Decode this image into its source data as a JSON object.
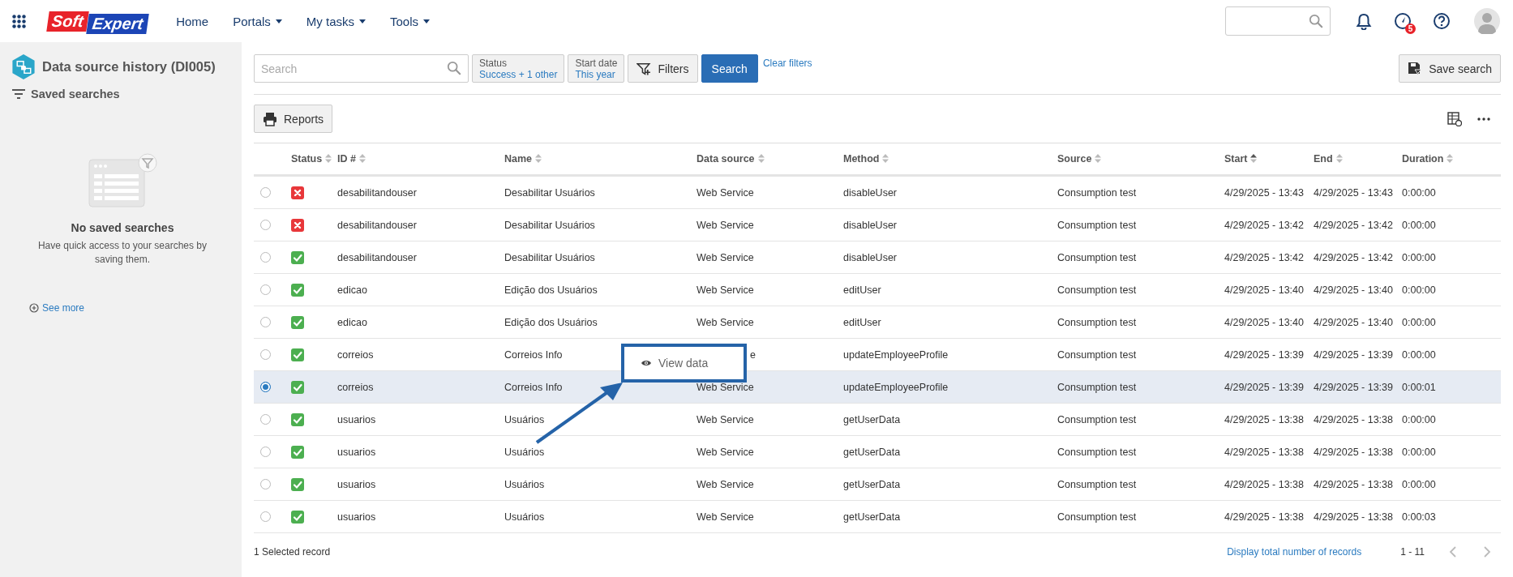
{
  "top_nav": {
    "logo": {
      "left": "Soft",
      "right": "Expert"
    },
    "menu": [
      {
        "label": "Home",
        "dropdown": false
      },
      {
        "label": "Portals",
        "dropdown": true
      },
      {
        "label": "My tasks",
        "dropdown": true
      },
      {
        "label": "Tools",
        "dropdown": true
      }
    ],
    "badge": "5"
  },
  "sidebar": {
    "title": "Data source history (DI005)",
    "saved_searches": "Saved searches",
    "empty_title": "No saved searches",
    "empty_text": "Have quick access to your searches by saving them.",
    "see_more": "See more"
  },
  "filter_bar": {
    "search": {
      "placeholder": "Search"
    },
    "chips": [
      {
        "label": "Status",
        "value": "Success + 1 other"
      },
      {
        "label": "Start date",
        "value": "This year"
      }
    ],
    "filters_button": "Filters",
    "search_button": "Search",
    "clear_filters": "Clear filters",
    "save_search": "Save search"
  },
  "reports_button": "Reports",
  "table": {
    "columns": [
      {
        "label": "Status",
        "sorted": false
      },
      {
        "label": "ID #",
        "sorted": false
      },
      {
        "label": "Name",
        "sorted": false
      },
      {
        "label": "Data source",
        "sorted": false
      },
      {
        "label": "Method",
        "sorted": false
      },
      {
        "label": "Source",
        "sorted": false
      },
      {
        "label": "Start",
        "sorted": true
      },
      {
        "label": "End",
        "sorted": false
      },
      {
        "label": "Duration",
        "sorted": false
      }
    ],
    "rows": [
      {
        "selected": false,
        "failed": true,
        "id": "desabilitandouser",
        "name": "Desabilitar Usuários",
        "data_source": "Web Service",
        "method": "disableUser",
        "source": "Consumption test",
        "start": "4/29/2025 - 13:43",
        "end": "4/29/2025 - 13:43",
        "duration": "0:00:00"
      },
      {
        "selected": false,
        "failed": true,
        "id": "desabilitandouser",
        "name": "Desabilitar Usuários",
        "data_source": "Web Service",
        "method": "disableUser",
        "source": "Consumption test",
        "start": "4/29/2025 - 13:42",
        "end": "4/29/2025 - 13:42",
        "duration": "0:00:00"
      },
      {
        "selected": false,
        "failed": false,
        "id": "desabilitandouser",
        "name": "Desabilitar Usuários",
        "data_source": "Web Service",
        "method": "disableUser",
        "source": "Consumption test",
        "start": "4/29/2025 - 13:42",
        "end": "4/29/2025 - 13:42",
        "duration": "0:00:00"
      },
      {
        "selected": false,
        "failed": false,
        "id": "edicao",
        "name": "Edição dos Usuários",
        "data_source": "Web Service",
        "method": "editUser",
        "source": "Consumption test",
        "start": "4/29/2025 - 13:40",
        "end": "4/29/2025 - 13:40",
        "duration": "0:00:00"
      },
      {
        "selected": false,
        "failed": false,
        "id": "edicao",
        "name": "Edição dos Usuários",
        "data_source": "Web Service",
        "method": "editUser",
        "source": "Consumption test",
        "start": "4/29/2025 - 13:40",
        "end": "4/29/2025 - 13:40",
        "duration": "0:00:00"
      },
      {
        "selected": false,
        "failed": false,
        "id": "correios",
        "name": "Correios Info",
        "data_source": "e",
        "data_source_covered": true,
        "method": "updateEmployeeProfile",
        "source": "Consumption test",
        "start": "4/29/2025 - 13:39",
        "end": "4/29/2025 - 13:39",
        "duration": "0:00:00"
      },
      {
        "selected": true,
        "failed": false,
        "id": "correios",
        "name": "Correios Info",
        "data_source": "Web Service",
        "method": "updateEmployeeProfile",
        "source": "Consumption test",
        "start": "4/29/2025 - 13:39",
        "end": "4/29/2025 - 13:39",
        "duration": "0:00:01"
      },
      {
        "selected": false,
        "failed": false,
        "id": "usuarios",
        "name": "Usuários",
        "data_source": "Web Service",
        "method": "getUserData",
        "source": "Consumption test",
        "start": "4/29/2025 - 13:38",
        "end": "4/29/2025 - 13:38",
        "duration": "0:00:00"
      },
      {
        "selected": false,
        "failed": false,
        "id": "usuarios",
        "name": "Usuários",
        "data_source": "Web Service",
        "method": "getUserData",
        "source": "Consumption test",
        "start": "4/29/2025 - 13:38",
        "end": "4/29/2025 - 13:38",
        "duration": "0:00:00"
      },
      {
        "selected": false,
        "failed": false,
        "id": "usuarios",
        "name": "Usuários",
        "data_source": "Web Service",
        "method": "getUserData",
        "source": "Consumption test",
        "start": "4/29/2025 - 13:38",
        "end": "4/29/2025 - 13:38",
        "duration": "0:00:00"
      },
      {
        "selected": false,
        "failed": false,
        "id": "usuarios",
        "name": "Usuários",
        "data_source": "Web Service",
        "method": "getUserData",
        "source": "Consumption test",
        "start": "4/29/2025 - 13:38",
        "end": "4/29/2025 - 13:38",
        "duration": "0:00:03"
      }
    ]
  },
  "context_menu": {
    "items": [
      {
        "label": "View data"
      }
    ]
  },
  "footer": {
    "selection": "1 Selected record",
    "total_link": "Display total number of records",
    "range": "1 - 11"
  }
}
